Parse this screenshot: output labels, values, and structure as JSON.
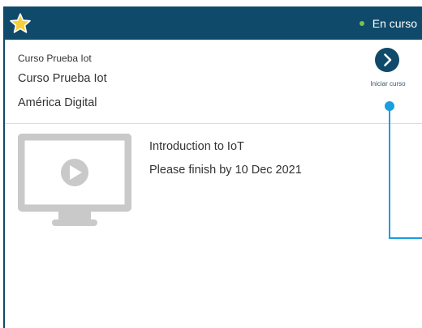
{
  "header": {
    "status_label": "En curso",
    "status_color": "#7ec04a",
    "star_color": "#f5cf3c",
    "background": "#0f4a6b"
  },
  "course": {
    "small_title": "Curso Prueba Iot",
    "title": "Curso Prueba Iot",
    "provider": "América Digital",
    "start_label": "Iniciar curso",
    "start_icon": "chevron-right-icon"
  },
  "module": {
    "title": "Introduction to IoT",
    "due": "Please finish by 10 Dec 2021",
    "thumbnail_icon": "video-monitor-icon"
  },
  "colors": {
    "accent": "#1a9ee0",
    "dark": "#0f4a6b"
  }
}
